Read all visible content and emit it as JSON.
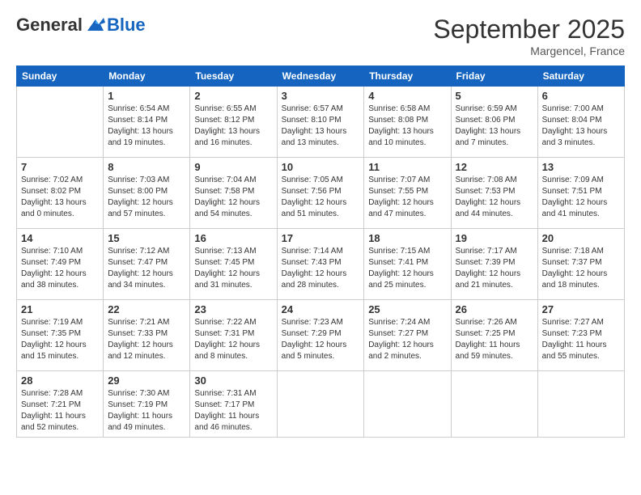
{
  "header": {
    "logo_general": "General",
    "logo_blue": "Blue",
    "month_title": "September 2025",
    "location": "Margencel, France"
  },
  "days_of_week": [
    "Sunday",
    "Monday",
    "Tuesday",
    "Wednesday",
    "Thursday",
    "Friday",
    "Saturday"
  ],
  "weeks": [
    [
      {
        "day": "",
        "content": ""
      },
      {
        "day": "1",
        "content": "Sunrise: 6:54 AM\nSunset: 8:14 PM\nDaylight: 13 hours\nand 19 minutes."
      },
      {
        "day": "2",
        "content": "Sunrise: 6:55 AM\nSunset: 8:12 PM\nDaylight: 13 hours\nand 16 minutes."
      },
      {
        "day": "3",
        "content": "Sunrise: 6:57 AM\nSunset: 8:10 PM\nDaylight: 13 hours\nand 13 minutes."
      },
      {
        "day": "4",
        "content": "Sunrise: 6:58 AM\nSunset: 8:08 PM\nDaylight: 13 hours\nand 10 minutes."
      },
      {
        "day": "5",
        "content": "Sunrise: 6:59 AM\nSunset: 8:06 PM\nDaylight: 13 hours\nand 7 minutes."
      },
      {
        "day": "6",
        "content": "Sunrise: 7:00 AM\nSunset: 8:04 PM\nDaylight: 13 hours\nand 3 minutes."
      }
    ],
    [
      {
        "day": "7",
        "content": "Sunrise: 7:02 AM\nSunset: 8:02 PM\nDaylight: 13 hours\nand 0 minutes."
      },
      {
        "day": "8",
        "content": "Sunrise: 7:03 AM\nSunset: 8:00 PM\nDaylight: 12 hours\nand 57 minutes."
      },
      {
        "day": "9",
        "content": "Sunrise: 7:04 AM\nSunset: 7:58 PM\nDaylight: 12 hours\nand 54 minutes."
      },
      {
        "day": "10",
        "content": "Sunrise: 7:05 AM\nSunset: 7:56 PM\nDaylight: 12 hours\nand 51 minutes."
      },
      {
        "day": "11",
        "content": "Sunrise: 7:07 AM\nSunset: 7:55 PM\nDaylight: 12 hours\nand 47 minutes."
      },
      {
        "day": "12",
        "content": "Sunrise: 7:08 AM\nSunset: 7:53 PM\nDaylight: 12 hours\nand 44 minutes."
      },
      {
        "day": "13",
        "content": "Sunrise: 7:09 AM\nSunset: 7:51 PM\nDaylight: 12 hours\nand 41 minutes."
      }
    ],
    [
      {
        "day": "14",
        "content": "Sunrise: 7:10 AM\nSunset: 7:49 PM\nDaylight: 12 hours\nand 38 minutes."
      },
      {
        "day": "15",
        "content": "Sunrise: 7:12 AM\nSunset: 7:47 PM\nDaylight: 12 hours\nand 34 minutes."
      },
      {
        "day": "16",
        "content": "Sunrise: 7:13 AM\nSunset: 7:45 PM\nDaylight: 12 hours\nand 31 minutes."
      },
      {
        "day": "17",
        "content": "Sunrise: 7:14 AM\nSunset: 7:43 PM\nDaylight: 12 hours\nand 28 minutes."
      },
      {
        "day": "18",
        "content": "Sunrise: 7:15 AM\nSunset: 7:41 PM\nDaylight: 12 hours\nand 25 minutes."
      },
      {
        "day": "19",
        "content": "Sunrise: 7:17 AM\nSunset: 7:39 PM\nDaylight: 12 hours\nand 21 minutes."
      },
      {
        "day": "20",
        "content": "Sunrise: 7:18 AM\nSunset: 7:37 PM\nDaylight: 12 hours\nand 18 minutes."
      }
    ],
    [
      {
        "day": "21",
        "content": "Sunrise: 7:19 AM\nSunset: 7:35 PM\nDaylight: 12 hours\nand 15 minutes."
      },
      {
        "day": "22",
        "content": "Sunrise: 7:21 AM\nSunset: 7:33 PM\nDaylight: 12 hours\nand 12 minutes."
      },
      {
        "day": "23",
        "content": "Sunrise: 7:22 AM\nSunset: 7:31 PM\nDaylight: 12 hours\nand 8 minutes."
      },
      {
        "day": "24",
        "content": "Sunrise: 7:23 AM\nSunset: 7:29 PM\nDaylight: 12 hours\nand 5 minutes."
      },
      {
        "day": "25",
        "content": "Sunrise: 7:24 AM\nSunset: 7:27 PM\nDaylight: 12 hours\nand 2 minutes."
      },
      {
        "day": "26",
        "content": "Sunrise: 7:26 AM\nSunset: 7:25 PM\nDaylight: 11 hours\nand 59 minutes."
      },
      {
        "day": "27",
        "content": "Sunrise: 7:27 AM\nSunset: 7:23 PM\nDaylight: 11 hours\nand 55 minutes."
      }
    ],
    [
      {
        "day": "28",
        "content": "Sunrise: 7:28 AM\nSunset: 7:21 PM\nDaylight: 11 hours\nand 52 minutes."
      },
      {
        "day": "29",
        "content": "Sunrise: 7:30 AM\nSunset: 7:19 PM\nDaylight: 11 hours\nand 49 minutes."
      },
      {
        "day": "30",
        "content": "Sunrise: 7:31 AM\nSunset: 7:17 PM\nDaylight: 11 hours\nand 46 minutes."
      },
      {
        "day": "",
        "content": ""
      },
      {
        "day": "",
        "content": ""
      },
      {
        "day": "",
        "content": ""
      },
      {
        "day": "",
        "content": ""
      }
    ]
  ]
}
